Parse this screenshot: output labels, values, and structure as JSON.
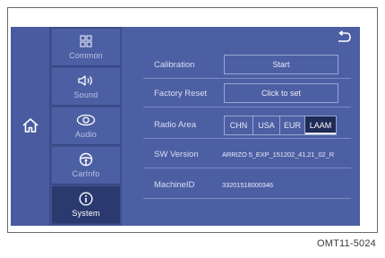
{
  "icons": {
    "home": "home-icon",
    "back": "back-arrow-icon",
    "common": "grid-icon",
    "sound": "speaker-icon",
    "audio": "audio-effect-icon",
    "carinfo": "steering-wheel-icon",
    "system": "info-icon"
  },
  "colors": {
    "screen": "#4d5fa3",
    "active_tab": "#2b3a6e",
    "text": "#d9def2"
  },
  "tabs": [
    {
      "label": "Common"
    },
    {
      "label": "Sound"
    },
    {
      "label": "Audio"
    },
    {
      "label": "CarInfo"
    },
    {
      "label": "System"
    }
  ],
  "active_tab": "System",
  "settings": {
    "calibration": {
      "label": "Calibration",
      "button": "Start"
    },
    "factory_reset": {
      "label": "Factory Reset",
      "button": "Click to set"
    },
    "radio_area": {
      "label": "Radio Area",
      "options": [
        "CHN",
        "USA",
        "EUR",
        "LAAM"
      ],
      "selected": "LAAM"
    },
    "sw_version": {
      "label": "SW Version",
      "value": "ARRIZO 5_EXP_151202_41.21_02_R"
    },
    "machine_id": {
      "label": "MachineID",
      "value": "33201518000346"
    }
  },
  "caption": "OMT11-5024"
}
